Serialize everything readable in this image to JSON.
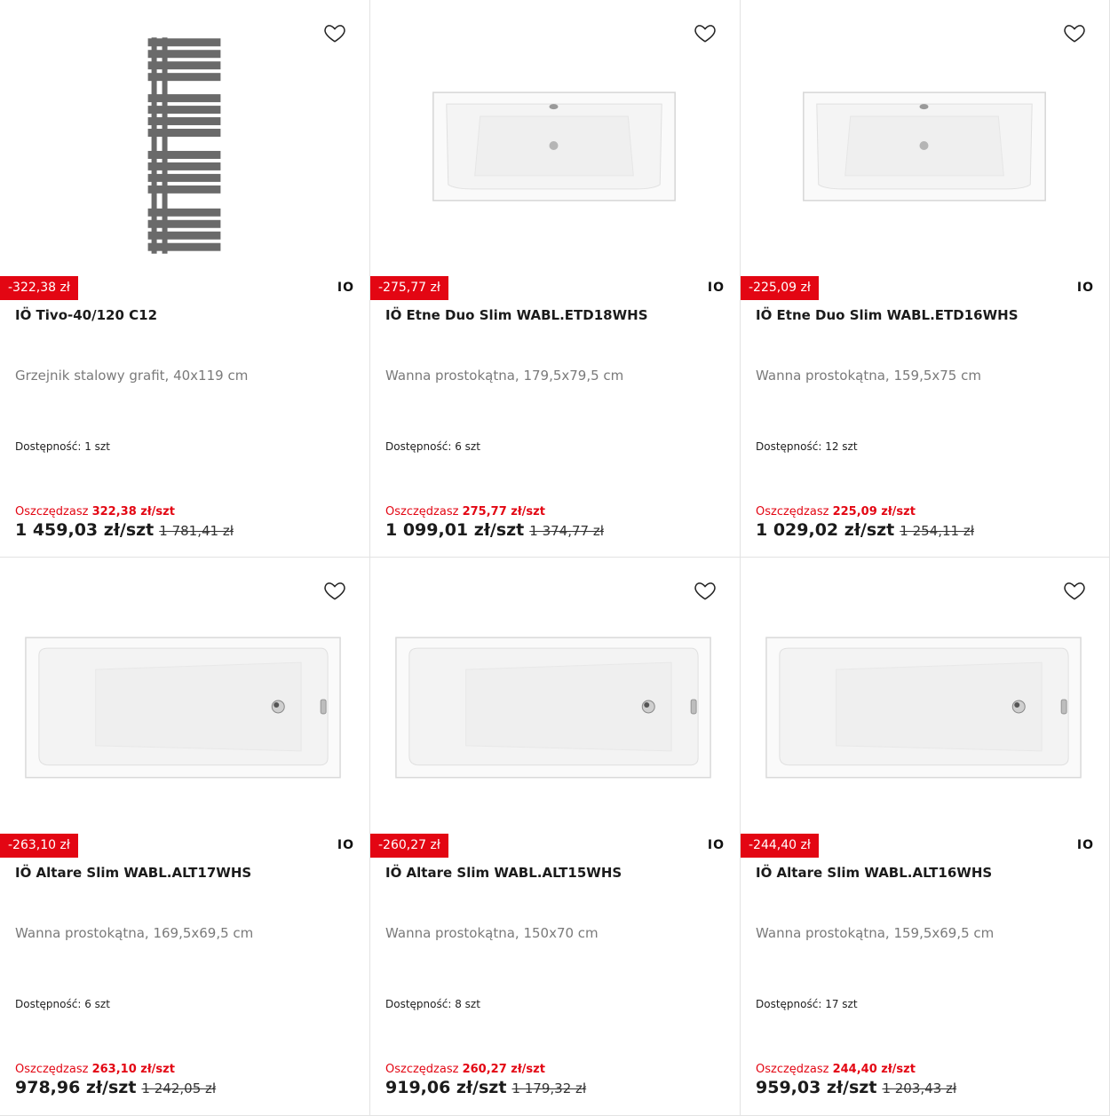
{
  "products": [
    {
      "discount": "-322,38 zł",
      "brand": "IO",
      "title": "IÖ Tivo-40/120 C12",
      "description": "Grzejnik stalowy grafit, 40x119 cm",
      "availability": "Dostępność: 1 szt",
      "save_label": "Oszczędzasz",
      "save_amount": "322,38 zł/szt",
      "price": "1 459,03 zł/szt",
      "old_price": "1 781,41 zł",
      "image": "radiator-image"
    },
    {
      "discount": "-275,77 zł",
      "brand": "IO",
      "title": "IÖ Etne Duo Slim WABL.ETD18WHS",
      "description": "Wanna prostokątna, 179,5x79,5 cm",
      "availability": "Dostępność: 6 szt",
      "save_label": "Oszczędzasz",
      "save_amount": "275,77 zł/szt",
      "price": "1 099,01 zł/szt",
      "old_price": "1 374,77 zł",
      "image": "bathtub-duo-image"
    },
    {
      "discount": "-225,09 zł",
      "brand": "IO",
      "title": "IÖ Etne Duo Slim WABL.ETD16WHS",
      "description": "Wanna prostokątna, 159,5x75 cm",
      "availability": "Dostępność: 12 szt",
      "save_label": "Oszczędzasz",
      "save_amount": "225,09 zł/szt",
      "price": "1 029,02 zł/szt",
      "old_price": "1 254,11 zł",
      "image": "bathtub-duo-image"
    },
    {
      "discount": "-263,10 zł",
      "brand": "IO",
      "title": "IÖ Altare Slim WABL.ALT17WHS",
      "description": "Wanna prostokątna, 169,5x69,5 cm",
      "availability": "Dostępność: 6 szt",
      "save_label": "Oszczędzasz",
      "save_amount": "263,10 zł/szt",
      "price": "978,96 zł/szt",
      "old_price": "1 242,05 zł",
      "image": "bathtub-single-image"
    },
    {
      "discount": "-260,27 zł",
      "brand": "IO",
      "title": "IÖ Altare Slim WABL.ALT15WHS",
      "description": "Wanna prostokątna, 150x70 cm",
      "availability": "Dostępność: 8 szt",
      "save_label": "Oszczędzasz",
      "save_amount": "260,27 zł/szt",
      "price": "919,06 zł/szt",
      "old_price": "1 179,32 zł",
      "image": "bathtub-single-image"
    },
    {
      "discount": "-244,40 zł",
      "brand": "IO",
      "title": "IÖ Altare Slim WABL.ALT16WHS",
      "description": "Wanna prostokątna, 159,5x69,5 cm",
      "availability": "Dostępność: 17 szt",
      "save_label": "Oszczędzasz",
      "save_amount": "244,40 zł/szt",
      "price": "959,03 zł/szt",
      "old_price": "1 203,43 zł",
      "image": "bathtub-single-image"
    }
  ],
  "colors": {
    "accent": "#e30613",
    "text": "#1b1b1b",
    "muted": "#7a7a7a",
    "radiator": "#6a6a6a"
  }
}
